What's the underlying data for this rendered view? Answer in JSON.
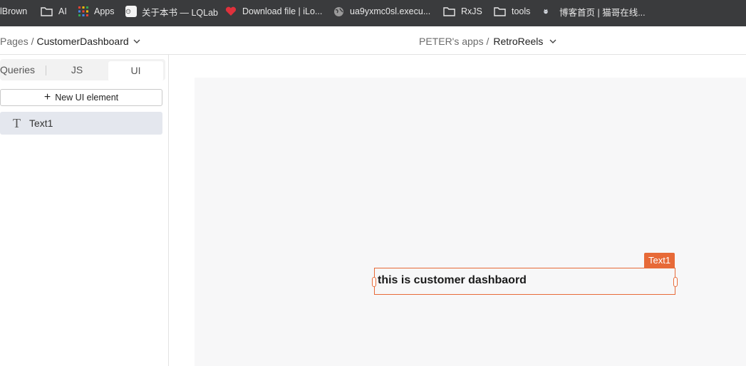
{
  "bookmarks": [
    {
      "label": "lBrown",
      "icon": "none"
    },
    {
      "label": "AI",
      "icon": "folder-icon"
    },
    {
      "label": "Apps",
      "icon": "apps-grid-icon"
    },
    {
      "label": "关于本书 — LQLab",
      "icon": "lqlab-favicon-icon"
    },
    {
      "label": "Download file | iLo...",
      "icon": "heart-favicon-icon"
    },
    {
      "label": "ua9yxmc0sl.execu...",
      "icon": "globe-icon"
    },
    {
      "label": "RxJS",
      "icon": "folder-icon"
    },
    {
      "label": "tools",
      "icon": "folder-icon"
    },
    {
      "label": "博客首页 | 猫哥在线...",
      "icon": "cat-favicon-icon"
    }
  ],
  "header": {
    "pages_prefix": "Pages /",
    "current_page": "CustomerDashboard",
    "apps_prefix": "PETER's apps /",
    "current_app": "RetroReels"
  },
  "sidebar": {
    "tabs": [
      {
        "label": "Queries"
      },
      {
        "label": "JS"
      },
      {
        "label": "UI",
        "active": true
      }
    ],
    "new_element_label": "New UI element",
    "items": [
      {
        "label": "Text1",
        "icon": "text-type-icon"
      }
    ]
  },
  "canvas": {
    "widget_tag": "Text1",
    "widget_text": "this is customer dashbaord"
  },
  "colors": {
    "accent": "#e76a38",
    "bookmarks_bg": "#3a3b3d",
    "canvas_bg": "#f7f7f8",
    "selected_item_bg": "#e4e7ee"
  }
}
